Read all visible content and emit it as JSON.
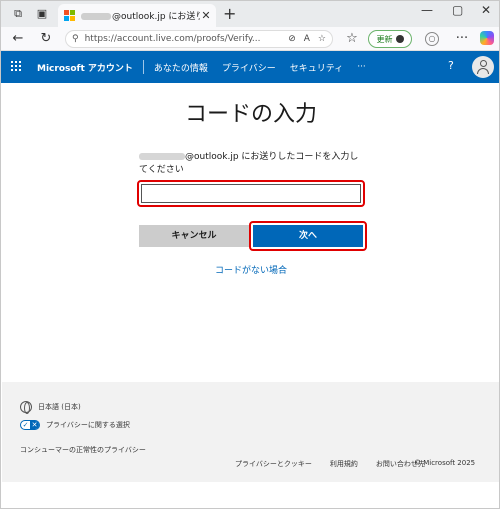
{
  "browser": {
    "tab_title_suffix": "@outlook.jp にお送りし",
    "url": "https://account.live.com/proofs/Verify...",
    "update_label": "更新"
  },
  "nav": {
    "brand": "Microsoft アカウント",
    "links": [
      "あなたの情報",
      "プライバシー",
      "セキュリティ",
      "···"
    ],
    "help": "?"
  },
  "main": {
    "title": "コードの入力",
    "desc_email_domain": "@outlook.jp",
    "desc_text": " にお送りしたコードを入力してください",
    "cancel_label": "キャンセル",
    "next_label": "次へ",
    "no_code_link": "コードがない場合"
  },
  "footer": {
    "language": "日本語 (日本)",
    "privacy_choice": "プライバシーに関する選択",
    "consumer_health": "コンシューマーの正常性のプライバシー",
    "links": [
      "プライバシーとクッキー",
      "利用規約",
      "お問い合わせ先"
    ],
    "copyright": "© Microsoft 2025"
  },
  "colors": {
    "accent": "#0067b8",
    "highlight": "#e00000",
    "footer_bg": "#f2f2f2"
  }
}
